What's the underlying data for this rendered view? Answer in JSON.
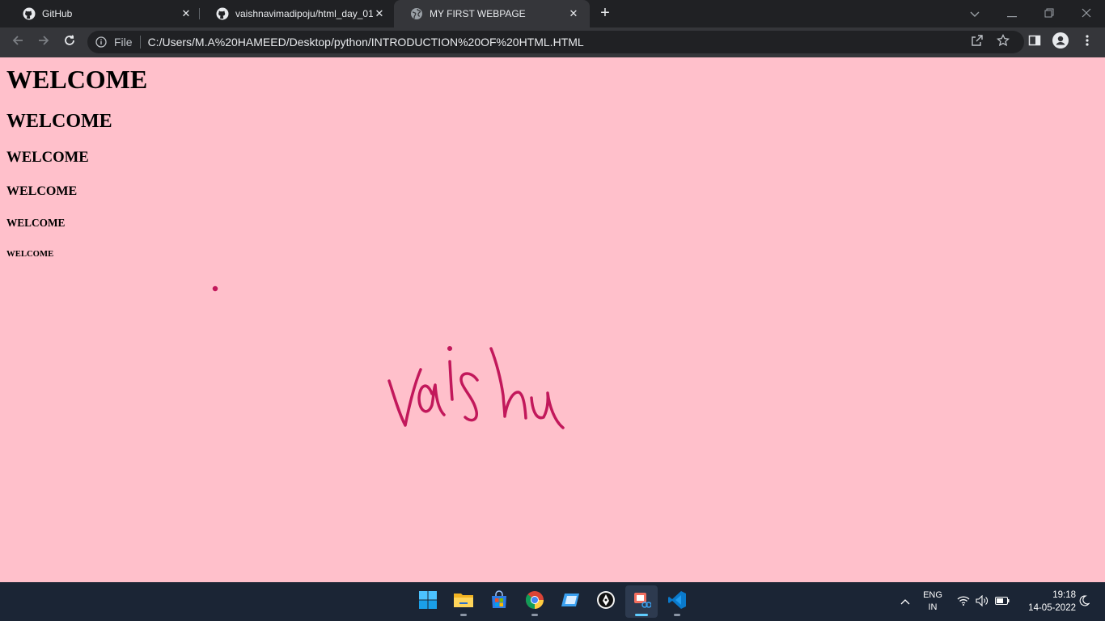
{
  "browser": {
    "tabs": [
      {
        "title": "GitHub",
        "icon": "github-icon",
        "active": false
      },
      {
        "title": "vaishnavimadipoju/html_day_01",
        "icon": "github-icon",
        "active": false
      },
      {
        "title": "MY FIRST WEBPAGE",
        "icon": "globe-icon",
        "active": true
      }
    ],
    "omnibox": {
      "scheme_label": "File",
      "url": "C:/Users/M.A%20HAMEED/Desktop/python/INTRODUCTION%20OF%20HTML.HTML"
    }
  },
  "page": {
    "background_color": "#ffc0cb",
    "headings": {
      "h1": "WELCOME",
      "h2": "WELCOME",
      "h3": "WELCOME",
      "h4": "WELCOME",
      "h5": "WELCOME",
      "h6": "WELCOME"
    },
    "signature": {
      "text": "vaishu",
      "color": "#c2185b"
    }
  },
  "taskbar": {
    "apps": [
      "windows-start-icon",
      "file-explorer-icon",
      "microsoft-store-icon",
      "chrome-icon",
      "app-icon",
      "pen-app-icon",
      "snipping-tool-icon",
      "vscode-icon"
    ],
    "language": {
      "line1": "ENG",
      "line2": "IN"
    },
    "clock": {
      "time": "19:18",
      "date": "14-05-2022"
    }
  }
}
